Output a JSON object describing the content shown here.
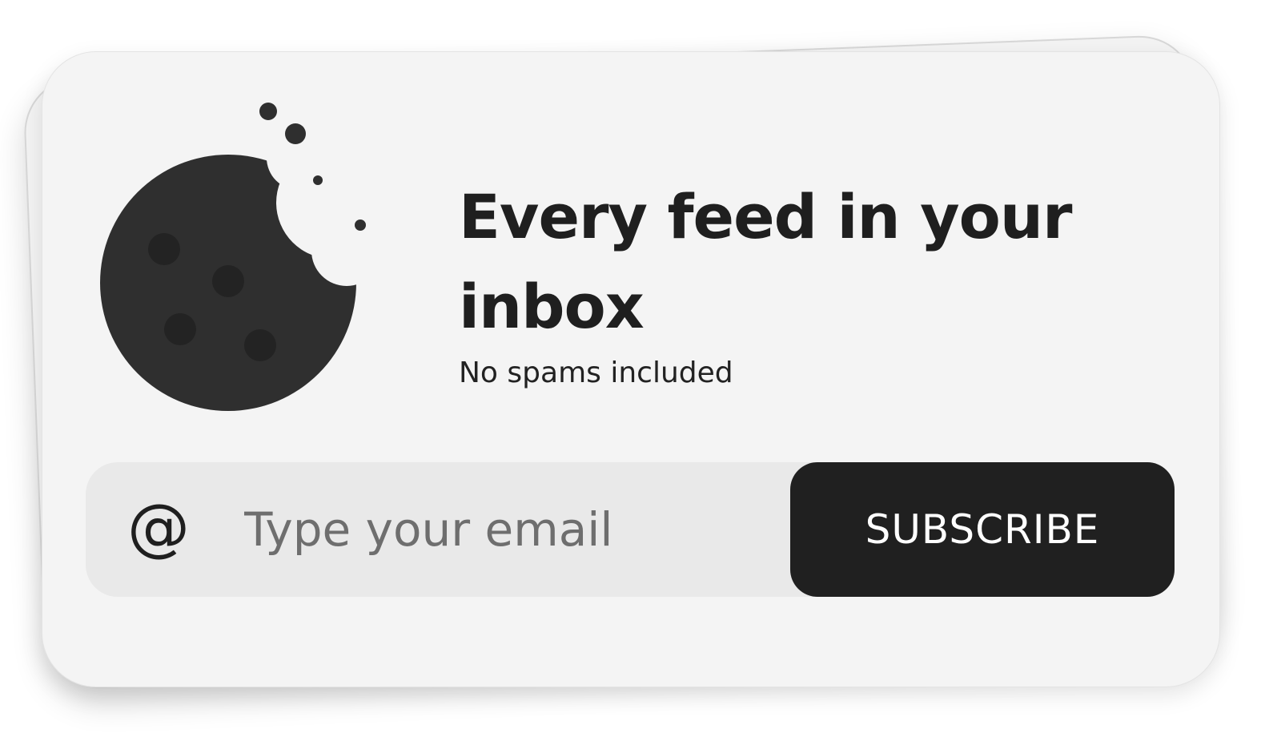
{
  "newsletter": {
    "headline": "Every feed in your inbox",
    "subtitle": "No spams included",
    "email_placeholder": "Type your email",
    "email_value": "",
    "subscribe_label": "SUBSCRIBE",
    "icons": {
      "illustration": "bitten-cookie-icon",
      "email": "at-sign-icon"
    },
    "colors": {
      "card_background": "#f4f4f4",
      "input_background": "#e9e9e9",
      "button_background": "#202020",
      "button_text": "#ffffff",
      "text": "#1f1f1f",
      "placeholder": "#6e6e6e"
    }
  }
}
